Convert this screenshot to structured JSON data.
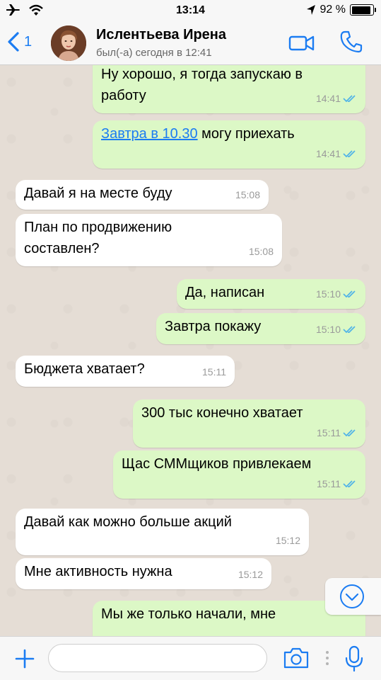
{
  "status_bar": {
    "time": "13:14",
    "battery": "92 %",
    "battery_level": 0.92,
    "icons": [
      "airplane-icon",
      "wifi-icon",
      "location-arrow-icon",
      "battery-icon"
    ]
  },
  "header": {
    "back_count": "1",
    "contact_name": "Ислентьева Ирена",
    "contact_status": "был(-а) сегодня в 12:41",
    "icons": [
      "video-call-icon",
      "phone-icon"
    ]
  },
  "messages": [
    {
      "dir": "out",
      "lines": [
        "Ну хорошо, я тогда запускаю в",
        "работу"
      ],
      "time": "14:41"
    },
    {
      "dir": "out",
      "link": "Завтра в 10.30",
      "text": " могу приехать",
      "time": "14:41"
    },
    {
      "dir": "in",
      "text": "Давай я на месте буду",
      "time": "15:08"
    },
    {
      "dir": "in",
      "lines": [
        "План по продвижению",
        "составлен?"
      ],
      "time": "15:08"
    },
    {
      "dir": "out",
      "text": "Да, написан",
      "time": "15:10"
    },
    {
      "dir": "out",
      "text": "Завтра покажу",
      "time": "15:10"
    },
    {
      "dir": "in",
      "text": "Бюджета хватает?",
      "time": "15:11"
    },
    {
      "dir": "out",
      "text": "300 тыс конечно хватает",
      "time": "15:11"
    },
    {
      "dir": "out",
      "text": "Щас СММщиков привлекаем",
      "time": "15:11"
    },
    {
      "dir": "in",
      "text": "Давай как можно больше акций",
      "time": "15:12"
    },
    {
      "dir": "in",
      "text": "Мне активность нужна",
      "time": "15:12"
    },
    {
      "dir": "out",
      "text": "Мы же только начали, мне",
      "time": ""
    }
  ],
  "colors": {
    "accent": "#1b7cf2",
    "outgoing_bubble": "#dcf8c6",
    "incoming_bubble": "#ffffff",
    "chat_background": "#e5ddd5",
    "read_ticks": "#4fb3e8"
  },
  "input_bar": {
    "placeholder": "",
    "icons": [
      "plus-icon",
      "camera-icon",
      "microphone-icon"
    ]
  }
}
